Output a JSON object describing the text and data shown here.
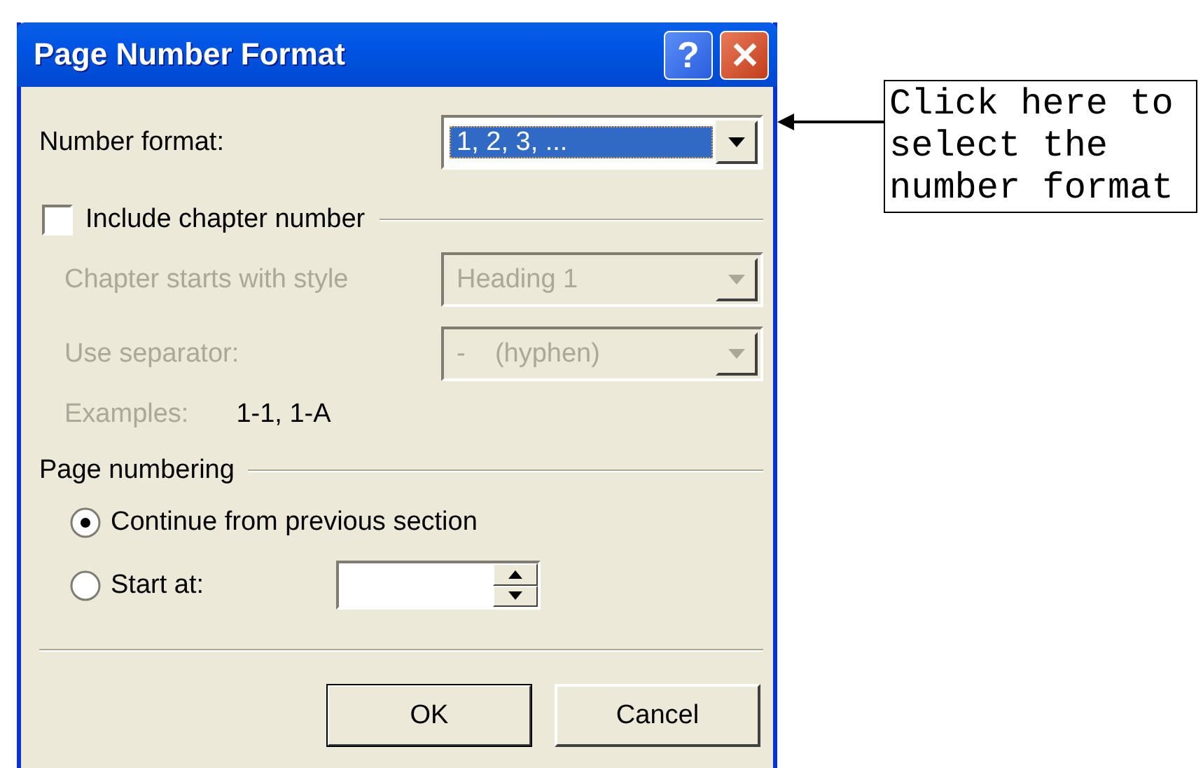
{
  "window": {
    "title": "Page Number Format",
    "help_button": "?"
  },
  "number_format": {
    "label": "Number format:",
    "value": "1, 2, 3, ...",
    "focused": true
  },
  "include_chapter": {
    "label": "Include chapter number",
    "checked": false
  },
  "chapter_style": {
    "label": "Chapter starts with style",
    "value": "Heading 1",
    "disabled": true
  },
  "separator": {
    "label": "Use separator:",
    "value": "-    (hyphen)",
    "disabled": true
  },
  "examples": {
    "label": "Examples:",
    "value": "1-1, 1-A",
    "disabled": true
  },
  "page_numbering": {
    "label": "Page numbering",
    "options": [
      {
        "label": "Continue from previous section",
        "selected": true
      },
      {
        "label": "Start at:",
        "selected": false
      }
    ]
  },
  "buttons": [
    {
      "label": "OK",
      "default": true
    },
    {
      "label": "Cancel",
      "default": false
    }
  ],
  "callout": {
    "text": "Click here to select the number format"
  }
}
